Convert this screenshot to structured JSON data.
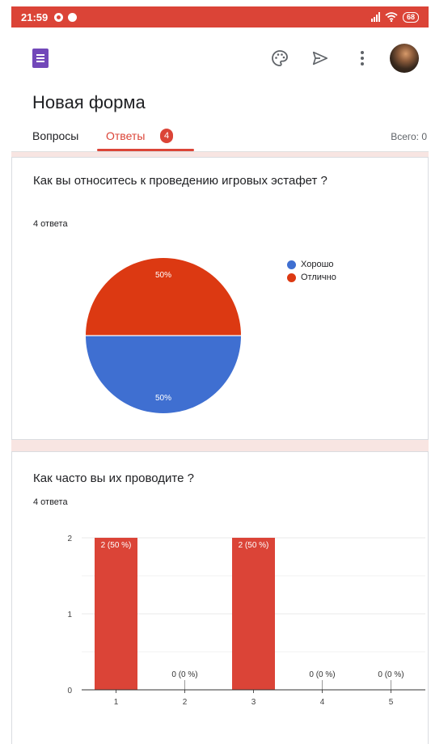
{
  "status_bar": {
    "time": "21:59",
    "battery": "68"
  },
  "header": {
    "title": "Новая форма"
  },
  "tabs": {
    "questions_label": "Вопросы",
    "responses_label": "Ответы",
    "responses_count": "4",
    "total_label": "Всего: 0"
  },
  "icons": {
    "forms_app": "forms-logo-icon",
    "customize": "palette-icon",
    "send": "send-icon",
    "more": "more-vert-icon",
    "account": "avatar"
  },
  "colors": {
    "accent": "#db4437",
    "blue": "#3f6fd1",
    "red": "#dc3912",
    "purple": "#7248b9"
  },
  "questions": [
    {
      "title": "Как вы относитесь к проведению игровых эстафет ?",
      "responses_label": "4 ответа",
      "chart_data": {
        "type": "pie",
        "slices": [
          {
            "label": "Хорошо",
            "value": 50,
            "color": "#3f6fd1"
          },
          {
            "label": "Отлично",
            "value": 50,
            "color": "#dc3912"
          }
        ],
        "value_labels": [
          "50%",
          "50%"
        ],
        "legend_position": "right"
      }
    },
    {
      "title": "Как часто вы их проводите ?",
      "responses_label": "4 ответа",
      "chart_data": {
        "type": "bar",
        "categories": [
          "1",
          "2",
          "3",
          "4",
          "5"
        ],
        "values": [
          2,
          0,
          2,
          0,
          0
        ],
        "bar_labels": [
          "2 (50 %)",
          "0 (0 %)",
          "2 (50 %)",
          "0 (0 %)",
          "0 (0 %)"
        ],
        "yticks": [
          "0",
          "1",
          "2"
        ],
        "ylim": [
          0,
          2
        ],
        "grid": true,
        "color": "#db4437"
      }
    }
  ]
}
